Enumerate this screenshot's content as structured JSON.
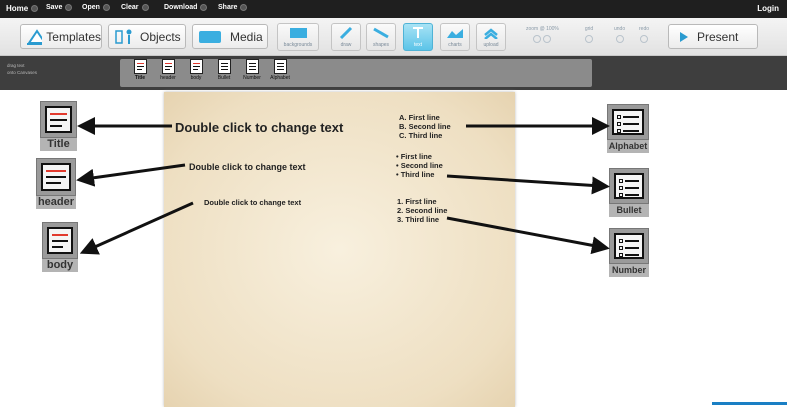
{
  "menu": {
    "home": "Home",
    "items": [
      "Save",
      "Open",
      "Clear",
      "Download",
      "Share"
    ],
    "login": "Login"
  },
  "toolbar": {
    "templates": "Templates",
    "objects": "Objects",
    "media": "Media",
    "tools": [
      "backgrounds",
      "draw",
      "shapes",
      "text",
      "charts",
      "upload"
    ],
    "active_tool": "text",
    "zoom": "zoom @ 100%",
    "grid": "grid",
    "undo": "undo",
    "redo": "redo",
    "present": "Present"
  },
  "subbar": {
    "hint_line1": "drag text",
    "hint_line2": "onto Canvases",
    "styles": [
      "Title",
      "header",
      "body",
      "Bullet",
      "Number",
      "Alphabet"
    ]
  },
  "canvas": {
    "title_text": "Double click to change text",
    "header_text": "Double click to change text",
    "body_text": "Double click to change text",
    "alpha_list": [
      "A. First line",
      "B. Second line",
      "C. Third line"
    ],
    "bullet_list": [
      "• First line",
      "• Second line",
      "• Third line"
    ],
    "number_list": [
      "1. First line",
      "2. Second line",
      "3. Third line"
    ]
  },
  "callouts": {
    "left": [
      "Title",
      "header",
      "body"
    ],
    "right": [
      "Alphabet",
      "Bullet",
      "Number"
    ]
  },
  "colors": {
    "menubar": "#1f1f1f",
    "accent": "#5cc4e8",
    "canvas": "#f1e4c8",
    "icon_red": "#e23a2e"
  }
}
